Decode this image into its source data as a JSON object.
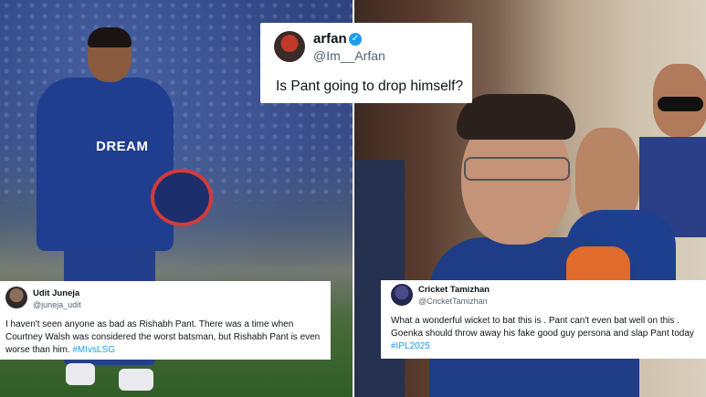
{
  "tweets": {
    "top": {
      "name": "arfan",
      "handle": "@Im__Arfan",
      "text": "Is Pant going to drop himself?",
      "verified_icon": "verified-badge-icon",
      "verified_color": "#1d9bf0"
    },
    "left": {
      "name": "Udit Juneja",
      "handle": "@juneja_udit",
      "text": "I haven't seen anyone as bad as Rishabh Pant. There was a time when Courtney Walsh was considered the worst batsman, but Rishabh Pant is even worse than him. ",
      "hashtag": "#MIvsLSG"
    },
    "right": {
      "name": "Cricket Tamizhan",
      "handle": "@CricketTamizhan",
      "text": "What a wonderful wicket to bat this is . Pant can't even bat well on this . Goenka should throw away his fake good guy persona and slap Pant today ",
      "hashtag": "#IPL2025"
    }
  },
  "photos": {
    "left_jersey_text": "DREAM"
  },
  "colors": {
    "hashtag": "#1d9bf0",
    "team_blue": "#1f3e8f",
    "team_orange": "#e06b2a"
  }
}
